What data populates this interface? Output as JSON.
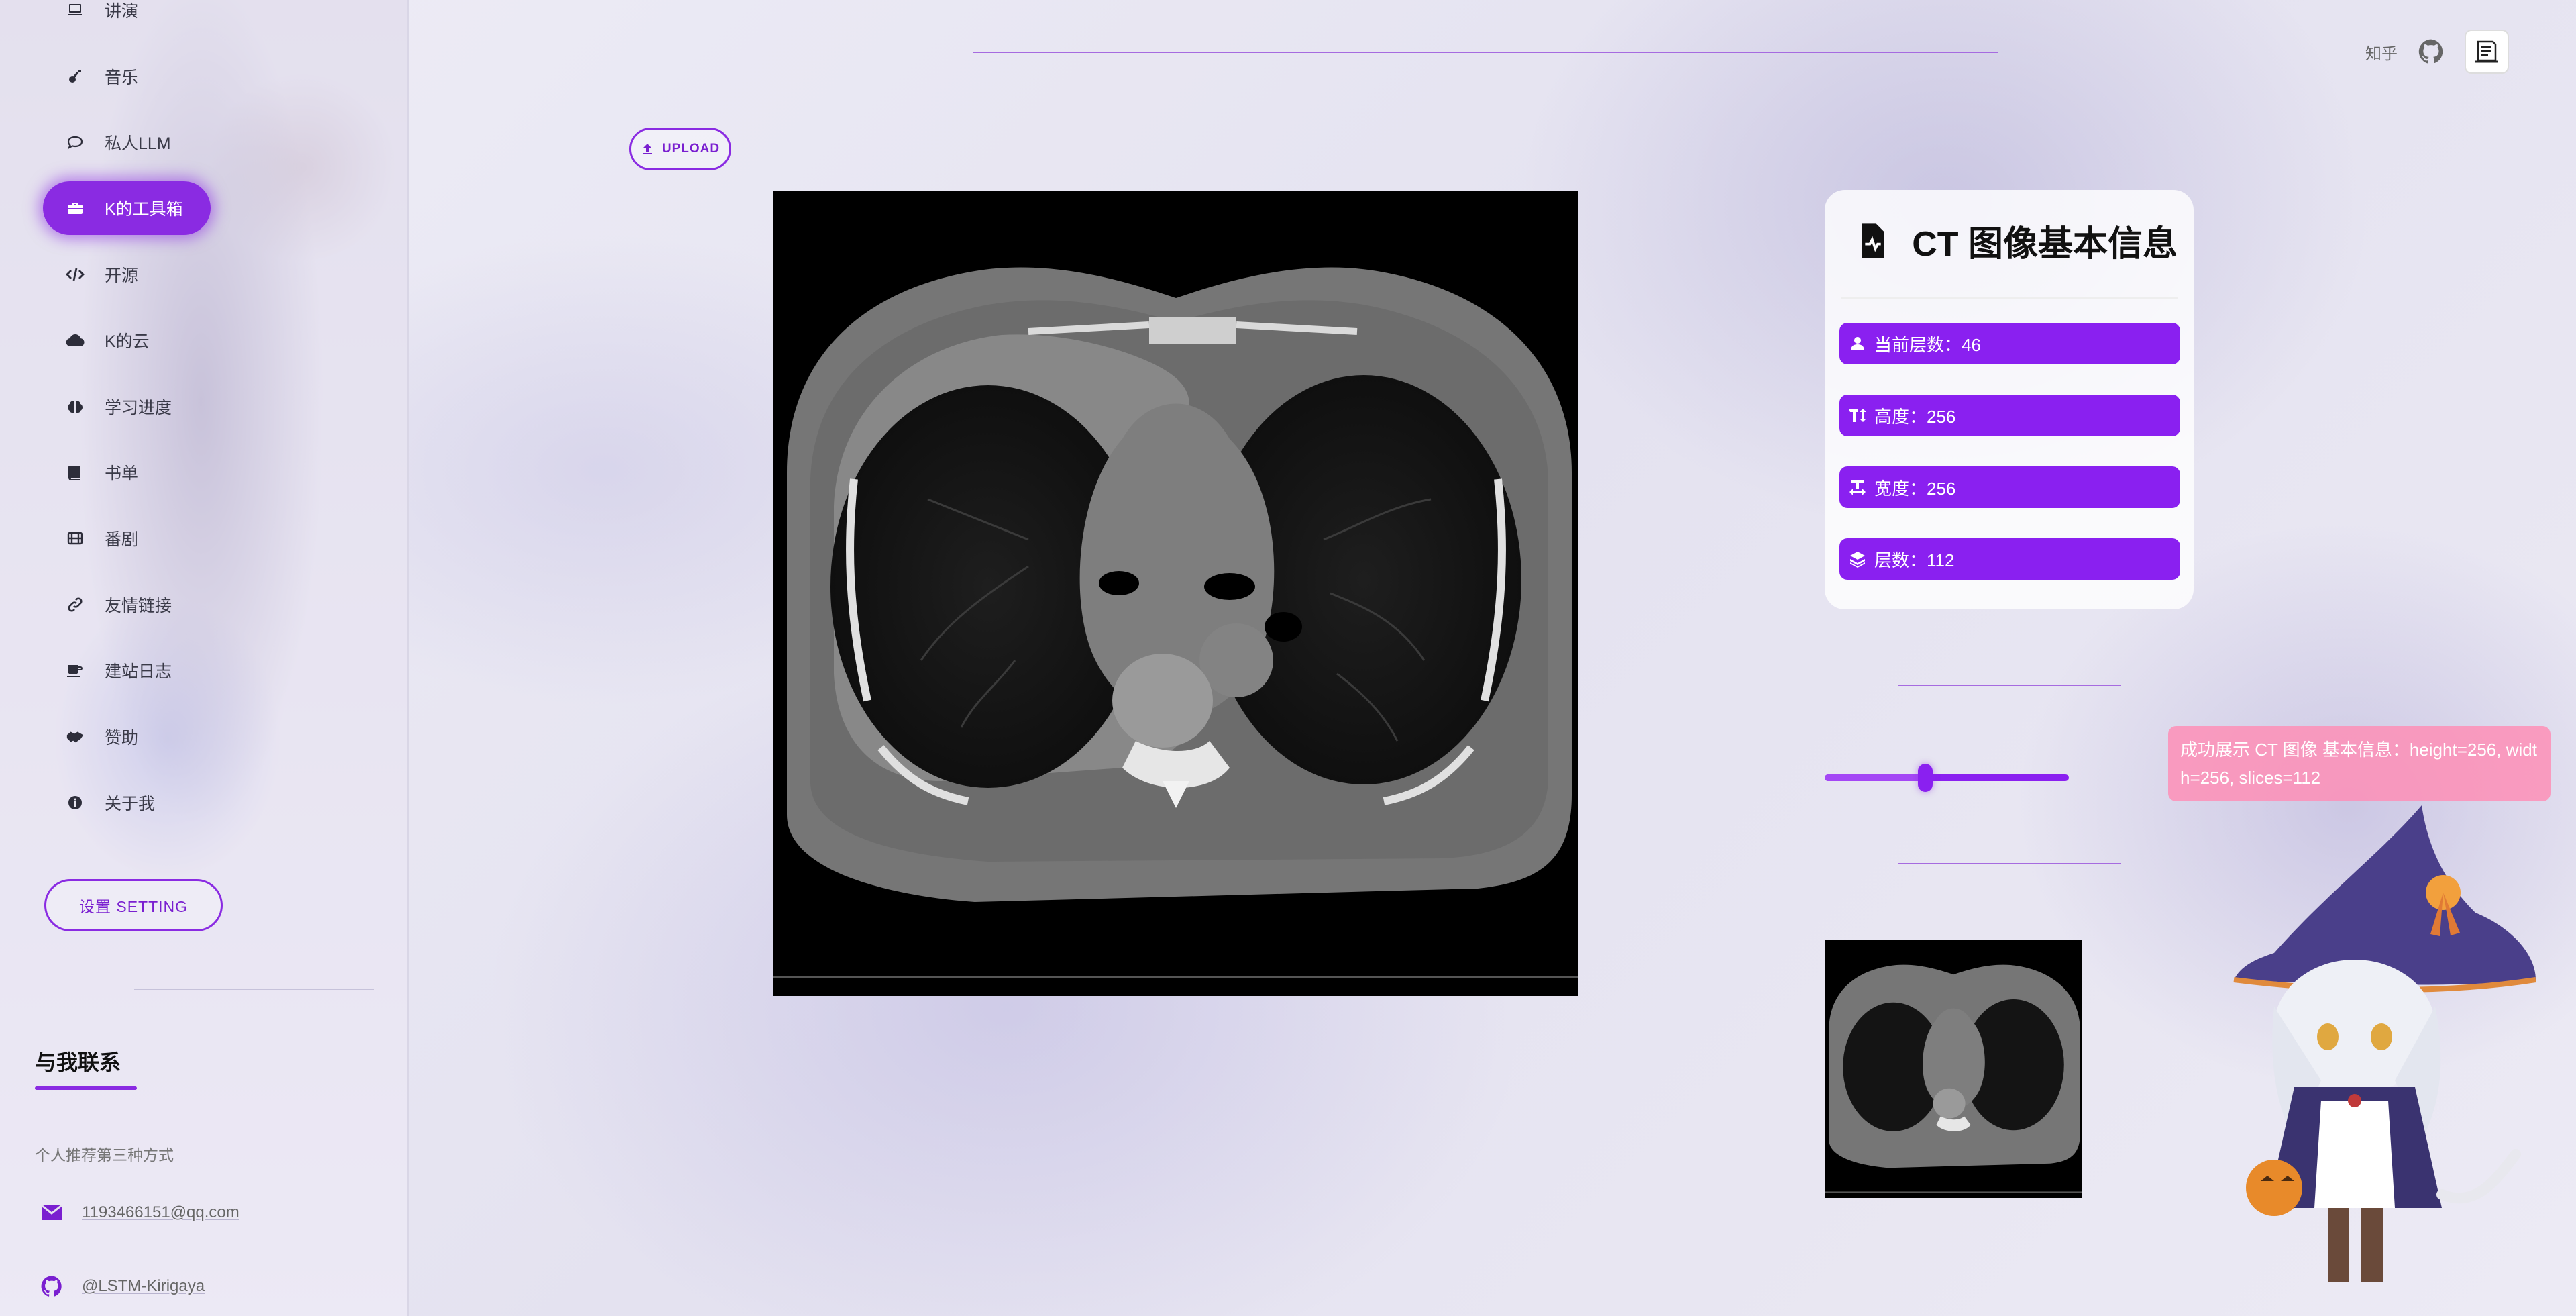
{
  "sidebar": {
    "items": [
      {
        "label": "讲演",
        "icon": "presentation-icon"
      },
      {
        "label": "音乐",
        "icon": "guitar-icon"
      },
      {
        "label": "私人LLM",
        "icon": "chat-icon"
      },
      {
        "label": "K的工具箱",
        "icon": "toolbox-icon",
        "active": true
      },
      {
        "label": "开源",
        "icon": "code-icon"
      },
      {
        "label": "K的云",
        "icon": "cloud-icon"
      },
      {
        "label": "学习进度",
        "icon": "brain-icon"
      },
      {
        "label": "书单",
        "icon": "book-icon"
      },
      {
        "label": "番剧",
        "icon": "film-icon"
      },
      {
        "label": "友情链接",
        "icon": "link-icon"
      },
      {
        "label": "建站日志",
        "icon": "coffee-icon"
      },
      {
        "label": "赞助",
        "icon": "handshake-icon"
      },
      {
        "label": "关于我",
        "icon": "info-icon"
      }
    ],
    "setting_label": "设置 SETTING",
    "contact": {
      "title": "与我联系",
      "subtitle": "个人推荐第三种方式",
      "email": "1193466151@qq.com",
      "github": "@LSTM-Kirigaya"
    }
  },
  "header": {
    "zhihu_label": "知乎"
  },
  "upload_label": "UPLOAD",
  "info": {
    "title": "CT 图像基本信息",
    "pills": [
      {
        "label": "当前层数：46",
        "icon": "user-icon"
      },
      {
        "label": "高度：256",
        "icon": "text-height-icon"
      },
      {
        "label": "宽度：256",
        "icon": "text-width-icon"
      },
      {
        "label": "层数：112",
        "icon": "layers-icon"
      }
    ]
  },
  "slider": {
    "value": 46,
    "min": 1,
    "max": 112
  },
  "toast": "成功展示 CT 图像 基本信息：height=256, width=256, slices=112",
  "colors": {
    "accent": "#8a2be2",
    "pill": "#8a20f0",
    "toast": "#ff8cb4"
  }
}
